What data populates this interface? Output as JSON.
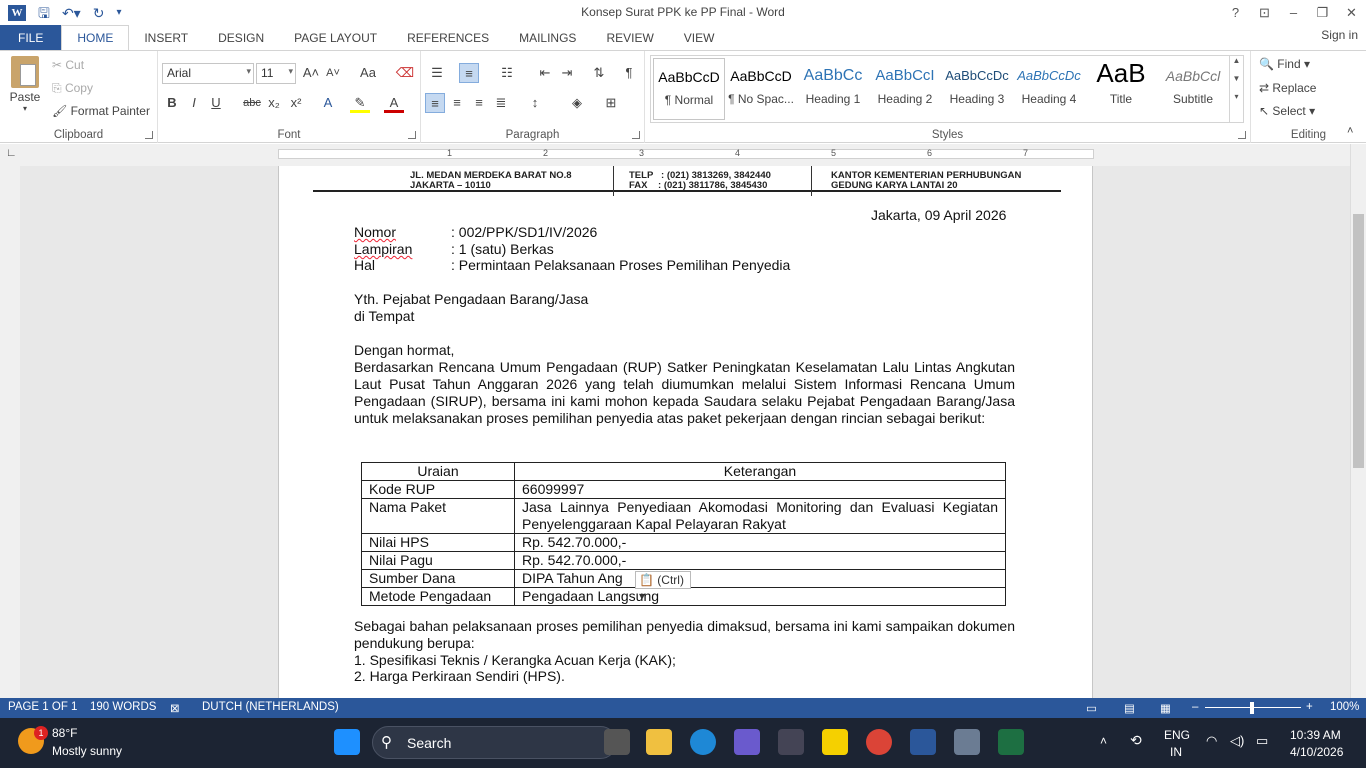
{
  "window": {
    "title": "Konsep Surat PPK ke PP Final - Word"
  },
  "tabs": [
    "FILE",
    "HOME",
    "INSERT",
    "DESIGN",
    "PAGE LAYOUT",
    "REFERENCES",
    "MAILINGS",
    "REVIEW",
    "VIEW"
  ],
  "signin": "Sign in",
  "clipboard": {
    "paste": "Paste",
    "cut": "Cut",
    "copy": "Copy",
    "format_painter": "Format Painter",
    "label": "Clipboard"
  },
  "font": {
    "name": "Arial",
    "size": "11",
    "label": "Font"
  },
  "paragraph": {
    "label": "Paragraph"
  },
  "styles": {
    "label": "Styles",
    "items": [
      {
        "preview": "AaBbCcD",
        "name": "¶ Normal"
      },
      {
        "preview": "AaBbCcD",
        "name": "¶ No Spac..."
      },
      {
        "preview": "AaBbCc",
        "name": "Heading 1"
      },
      {
        "preview": "AaBbCcI",
        "name": "Heading 2"
      },
      {
        "preview": "AaBbCcDc",
        "name": "Heading 3"
      },
      {
        "preview": "AaBbCcDc",
        "name": "Heading 4"
      },
      {
        "preview": "AaB",
        "name": "Title"
      },
      {
        "preview": "AaBbCcl",
        "name": "Subtitle"
      }
    ]
  },
  "editing": {
    "find": "Find",
    "replace": "Replace",
    "select": "Select",
    "label": "Editing"
  },
  "ruler": {
    "numbers": [
      "1",
      "2",
      "3",
      "4",
      "5",
      "6",
      "7"
    ]
  },
  "letterhead": {
    "left": "JL. MEDAN MERDEKA BARAT NO.8\nJAKARTA – 10110",
    "mid": "TELP   : (021) 3813269, 3842440\nFAX    : (021) 3811786, 3845430",
    "right": "KANTOR KEMENTERIAN PERHUBUNGAN\nGEDUNG KARYA LANTAI 20"
  },
  "letter": {
    "date": "Jakarta, 09 April 2026",
    "nomor_label": "Nomor",
    "nomor_value": ": 002/PPK/SD1/IV/2026",
    "lampiran_label": "Lampiran",
    "lampiran_value": ": 1 (satu) Berkas",
    "hal_label": "Hal",
    "hal_value": ": Permintaan Pelaksanaan Proses Pemilihan Penyedia",
    "to1": "Yth. Pejabat Pengadaan Barang/Jasa",
    "to2": "di Tempat",
    "greeting": "Dengan hormat,",
    "body": "Berdasarkan Rencana Umum Pengadaan (RUP) Satker Peningkatan Keselamatan Lalu Lintas Angkutan Laut Pusat Tahun Anggaran 2026 yang telah diumumkan melalui Sistem Informasi Rencana Umum Pengadaan (SIRUP), bersama ini kami mohon kepada Saudara selaku Pejabat Pengadaan Barang/Jasa untuk melaksanakan proses pemilihan penyedia atas paket pekerjaan dengan rincian sebagai berikut:",
    "table_headers": [
      "Uraian",
      "Keterangan"
    ],
    "table_rows": [
      [
        "Kode RUP",
        "66099997"
      ],
      [
        "Nama Paket",
        "Jasa Lainnya Penyediaan Akomodasi Monitoring dan Evaluasi Kegiatan Penyelenggaraan Kapal Pelayaran Rakyat"
      ],
      [
        "Nilai HPS",
        "Rp. 542.70.000,-"
      ],
      [
        "Nilai Pagu",
        "Rp. 542.70.000,-"
      ],
      [
        "Sumber Dana",
        "DIPA Tahun Ang        26"
      ],
      [
        "Metode Pengadaan",
        "Pengadaan Langsung"
      ]
    ],
    "closing": "Sebagai bahan pelaksanaan proses pemilihan penyedia dimaksud, bersama ini kami sampaikan dokumen pendukung berupa:",
    "item1": "1.  Spesifikasi Teknis / Kerangka Acuan Kerja (KAK);",
    "item2": "2.  Harga Perkiraan Sendiri (HPS)."
  },
  "paste_options": "(Ctrl)",
  "status": {
    "page": "PAGE 1 OF 1",
    "words": "190 WORDS",
    "language": "DUTCH (NETHERLANDS)",
    "zoom": "100%"
  },
  "taskbar": {
    "temp": "88°F",
    "weather": "Mostly sunny",
    "search": "Search",
    "lang1": "ENG",
    "lang2": "IN",
    "time": "10:39 AM",
    "date": "4/10/2026",
    "badge": "1"
  }
}
